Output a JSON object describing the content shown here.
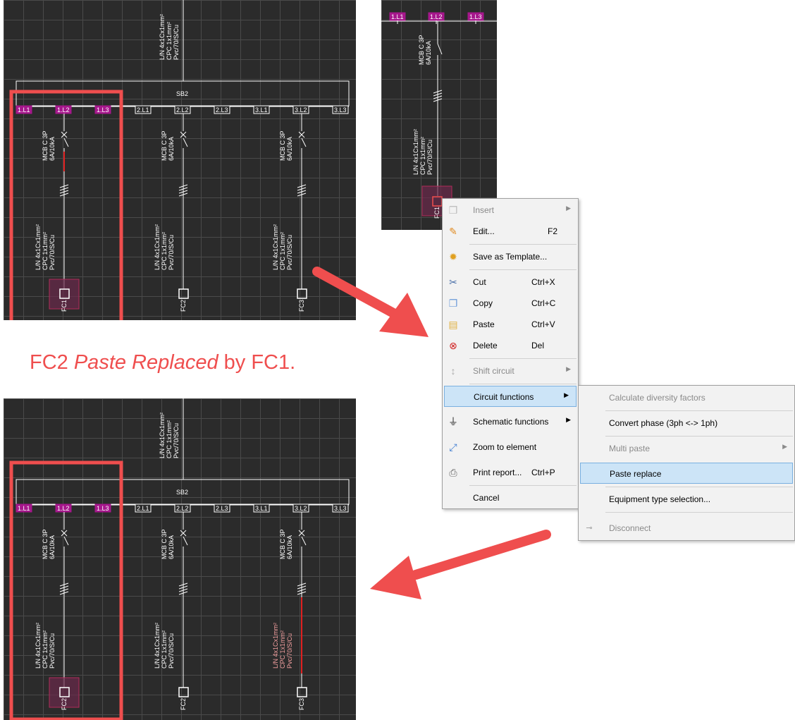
{
  "top_diagram": {
    "board": "SB2",
    "feed_cable": [
      "L/N 4x1Cx1mm²",
      "CPC 1x1mm²",
      "Pvc/70/S/Cu"
    ],
    "phase_tags": [
      "1.L1",
      "1.L2",
      "1.L3",
      "2.L1",
      "2.L2",
      "2.L3",
      "3.L1",
      "3.L2",
      "3.L3"
    ],
    "breaker": [
      "MCB C 3P",
      "6A/10kA"
    ],
    "cable": [
      "L/N 4x1Cx1mm²",
      "CPC 1x1mm²",
      "Pvc/70/S/Cu"
    ],
    "circuits": [
      "FC1",
      "FC2",
      "FC3"
    ]
  },
  "bottom_diagram": {
    "board": "SB2",
    "circuits": [
      "FC2",
      "FC2",
      "FC3"
    ]
  },
  "preview": {
    "phase_tags": [
      "1.L1",
      "1.L2",
      "1.L3"
    ],
    "circuit": "FC1"
  },
  "caption": {
    "part1": "FC2 ",
    "part2": "Paste Replaced",
    "part3": " by FC1."
  },
  "context_menu": {
    "items": [
      {
        "label": "Insert",
        "shortcut": "",
        "icon": "insert-icon",
        "submenu": true,
        "disabled": true
      },
      {
        "label": "Edit...",
        "shortcut": "F2",
        "icon": "edit-icon"
      },
      {
        "label": "Save as Template...",
        "shortcut": "",
        "icon": "template-icon"
      },
      {
        "label": "Cut",
        "shortcut": "Ctrl+X",
        "icon": "cut-icon"
      },
      {
        "label": "Copy",
        "shortcut": "Ctrl+C",
        "icon": "copy-icon"
      },
      {
        "label": "Paste",
        "shortcut": "Ctrl+V",
        "icon": "paste-icon"
      },
      {
        "label": "Delete",
        "shortcut": "Del",
        "icon": "delete-icon"
      },
      {
        "label": "Shift circuit",
        "shortcut": "",
        "icon": "shift-icon",
        "submenu": true,
        "disabled": true
      },
      {
        "label": "Circuit functions",
        "shortcut": "",
        "icon": "",
        "submenu": true,
        "highlighted": true
      },
      {
        "label": "Schematic functions",
        "shortcut": "",
        "icon": "schematic-icon",
        "submenu": true
      },
      {
        "label": "Zoom to element",
        "shortcut": "",
        "icon": "zoom-icon"
      },
      {
        "label": "Print report...",
        "shortcut": "Ctrl+P",
        "icon": "print-icon"
      },
      {
        "label": "Cancel",
        "shortcut": "",
        "icon": ""
      }
    ]
  },
  "submenu": {
    "items": [
      {
        "label": "Calculate diversity factors",
        "disabled": true
      },
      {
        "label": "Convert phase (3ph <-> 1ph)"
      },
      {
        "label": "Multi paste",
        "disabled": true,
        "submenu": true
      },
      {
        "label": "Paste replace",
        "highlighted": true
      },
      {
        "label": "Equipment type selection..."
      },
      {
        "label": "Disconnect",
        "disabled": true,
        "icon": "disconnect-icon"
      }
    ]
  },
  "colors": {
    "canvas": "#2b2b2b",
    "grid": "#4a4a4a",
    "tag": "#a6178c",
    "highlight_box": "#ef4e4e",
    "arrow": "#ef4e4e",
    "menu_highlight": "#cce4f7"
  }
}
